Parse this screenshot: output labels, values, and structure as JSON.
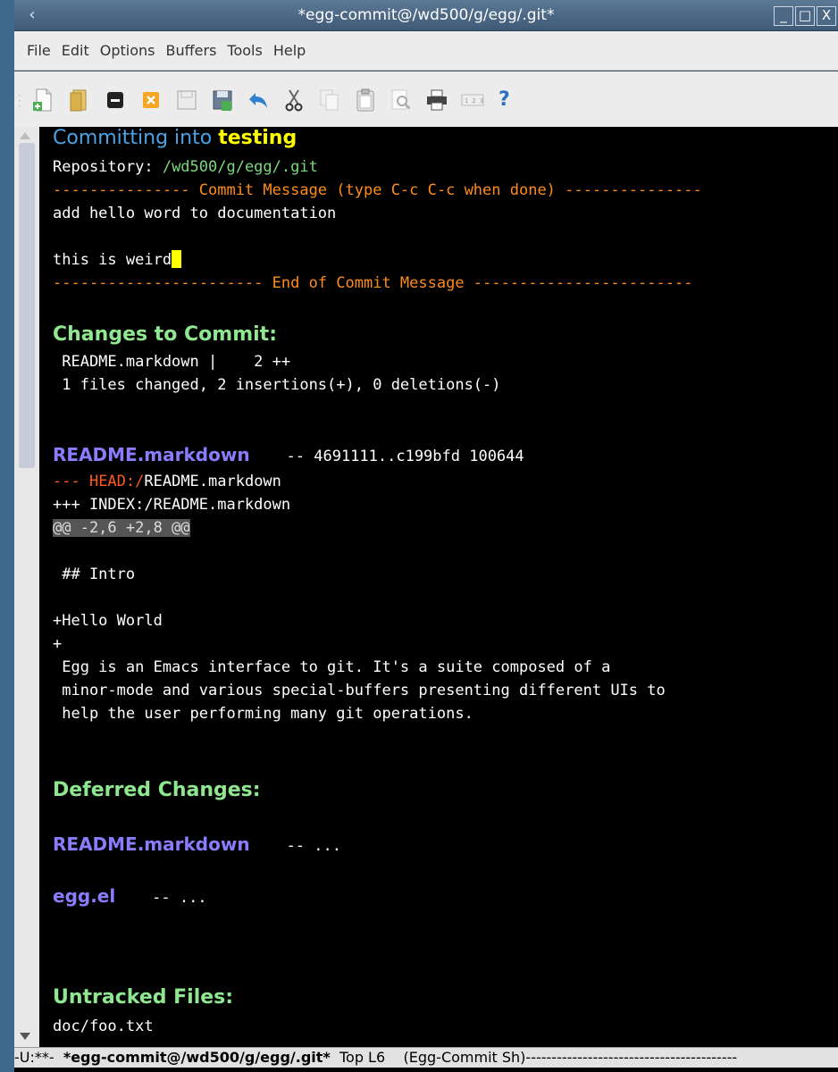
{
  "window": {
    "title": "*egg-commit@/wd500/g/egg/.git*",
    "app_icon": "‹",
    "controls": {
      "minimize": "_",
      "maximize": "□",
      "close": "X"
    }
  },
  "menu": [
    "File",
    "Edit",
    "Options",
    "Buffers",
    "Tools",
    "Help"
  ],
  "toolbar": {
    "icons": [
      "new-file-icon",
      "open-folder-icon",
      "close-buffer-icon",
      "cancel-icon",
      "save-icon",
      "save-as-icon",
      "undo-icon",
      "cut-icon",
      "copy-icon",
      "paste-icon",
      "search-icon",
      "print-icon",
      "customize-icon",
      "help-icon"
    ],
    "help_glyph": "?"
  },
  "buffer": {
    "heading_prefix": "Committing into ",
    "branch": "testing",
    "repo_label": "Repository: ",
    "repo_path": "/wd500/g/egg/.git",
    "commit_msg_separator": "--------------- Commit Message (type C-c C-c when done) ---------------",
    "commit_msg_lines": [
      "add hello word to documentation",
      "",
      "this is weird"
    ],
    "end_separator": "----------------------- End of Commit Message ------------------------",
    "changes_heading": "Changes to Commit:",
    "stat_lines": [
      " README.markdown |    2 ++",
      " 1 files changed, 2 insertions(+), 0 deletions(-)"
    ],
    "diff_file": "README.markdown",
    "diff_file_info": "-- 4691111..c199bfd 100644",
    "diff_head_prefix": "--- ",
    "diff_head_label": "HEAD:/",
    "diff_head_path": "README.markdown",
    "diff_index": "+++ INDEX:/README.markdown",
    "hunk_header": "@@ -2,6 +2,8 @@",
    "hunk_lines": [
      " ## Intro",
      "",
      "+Hello World",
      "+",
      " Egg is an Emacs interface to git. It's a suite composed of a",
      " minor-mode and various special-buffers presenting different UIs to",
      " help the user performing many git operations."
    ],
    "deferred_heading": "Deferred Changes:",
    "deferred_files": [
      {
        "name": "README.markdown",
        "info": "-- ..."
      },
      {
        "name": "egg.el",
        "info": "-- ..."
      }
    ],
    "untracked_heading": "Untracked Files:",
    "untracked_files": [
      "doc/foo.txt"
    ]
  },
  "modeline": {
    "status": "-U:**-  ",
    "buffer_name": "*egg-commit@/wd500/g/egg/.git*",
    "position": "  Top L6    ",
    "mode": "(Egg-Commit Sh)",
    "fill": "-----------------------------------------"
  },
  "colors": {
    "background": "#000000",
    "branch": "#ffff00",
    "section": "#8fe88f",
    "file": "#8b7cff",
    "separator": "#ff8c1a"
  }
}
